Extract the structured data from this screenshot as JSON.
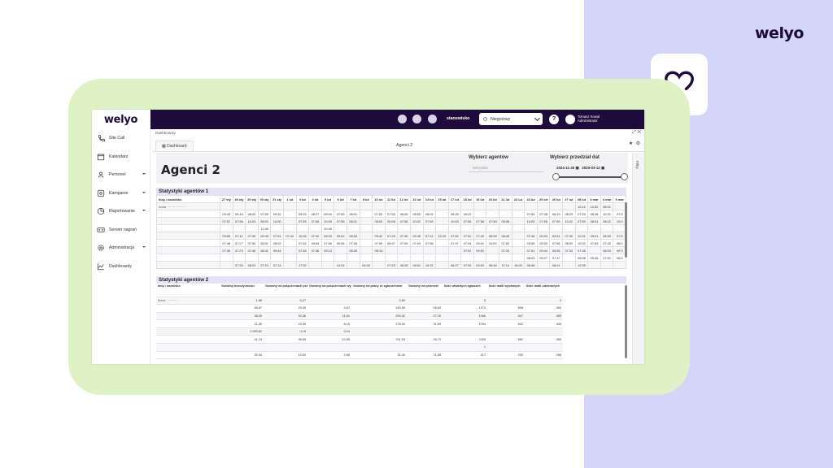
{
  "brand": "welyo",
  "sidebar": {
    "logo": "welyo",
    "items": [
      {
        "label": "Site Call",
        "icon": "phone-icon",
        "caret": false
      },
      {
        "label": "Kalendarz",
        "icon": "calendar-icon",
        "caret": false
      },
      {
        "label": "Personel",
        "icon": "users-icon",
        "caret": true
      },
      {
        "label": "Kampanie",
        "icon": "campaign-icon",
        "caret": true
      },
      {
        "label": "Raportowanie",
        "icon": "pie-chart-icon",
        "caret": true
      },
      {
        "label": "Serwer nagrań",
        "icon": "tape-icon",
        "caret": false
      },
      {
        "label": "Administracja",
        "icon": "gear-icon",
        "caret": true
      },
      {
        "label": "Dashboardy",
        "icon": "trend-chart-icon",
        "caret": false
      }
    ]
  },
  "topbar": {
    "stanowisko": "stanowisko",
    "status": "Niegotowy",
    "help": "?",
    "user_line1": "Tomasz Kowal",
    "user_line2": "Administrator",
    "accent": "#1e0b3b",
    "status_ok": "#58c34e"
  },
  "breadcrumb": "Dashboardy",
  "tab": {
    "label": "Dashboard",
    "title": "Agenci 2"
  },
  "filters": {
    "page_title": "Agenci 2",
    "agents_label": "Wybierz agentów",
    "agents_placeholder": "Wszystkie",
    "range_label": "Wybierz przedział dat",
    "date_from": "2024-11-26",
    "date_to": "2025-03-12",
    "side_panel": "Filtry"
  },
  "stats1": {
    "title": "Statystyki agentów 1",
    "name_header": "Imię i nazwisko",
    "date_headers": [
      "27 sty",
      "28 sty",
      "29 sty",
      "30 sty",
      "31 sty",
      "1 lut",
      "3 lut",
      "4 lut",
      "5 lut",
      "6 lut",
      "7 lut",
      "8 lut",
      "10 lut",
      "11 lut",
      "12 lut",
      "13 lut",
      "14 lut",
      "15 lut",
      "17 lut",
      "18 lut",
      "19 lut",
      "20 lut",
      "21 lut",
      "23 lut",
      "24 lut",
      "25 lut",
      "26 lut",
      "27 lut",
      "28 lut",
      "3 mar",
      "4 mar",
      "5 mar"
    ],
    "rows": [
      {
        "name": "Anna ·················",
        "cells": [
          "",
          "",
          "",
          "",
          "",
          "",
          "",
          "",
          "",
          "",
          "",
          "",
          "",
          "",
          "",
          "",
          "",
          "",
          "",
          "",
          "",
          "",
          "",
          "",
          "",
          "",
          "",
          "",
          "10:12",
          "12:52",
          "08:01",
          ""
        ]
      },
      {
        "name": "",
        "cells": [
          "09:43",
          "09:44",
          "08:03",
          "07:59",
          "09:32",
          "",
          "09:15",
          "08:27",
          "08:00",
          "07:59",
          "08:01",
          "",
          "07:59",
          "07:55",
          "08:26",
          "08:59",
          "08:01",
          "",
          "08:25",
          "09:22",
          "",
          "",
          "",
          "",
          "07:54",
          "07:38",
          "08:19",
          "08:23",
          "07:53",
          "08:38",
          "10:21",
          "07:5"
        ]
      },
      {
        "name": "",
        "cells": [
          "07:57",
          "07:56",
          "10:03",
          "08:01",
          "10:00",
          "",
          "07:59",
          "07:56",
          "10:09",
          "07:58",
          "08:01",
          "",
          "08:00",
          "09:58",
          "07:56",
          "10:02",
          "07:59",
          "",
          "10:00",
          "07:55",
          "07:58",
          "07:58",
          "09:59",
          "",
          "10:00",
          "07:55",
          "07:59",
          "10:02",
          "07:59",
          "08:01",
          "08:12",
          "10:0"
        ]
      },
      {
        "name": "",
        "cells": [
          "",
          "",
          "",
          "11:45",
          "",
          "",
          "",
          "",
          "10:45",
          "",
          "",
          "",
          "",
          "",
          "",
          "",
          "",
          "",
          "",
          "",
          "",
          "",
          "",
          "",
          "",
          "",
          "",
          "",
          "",
          "",
          "",
          ""
        ]
      },
      {
        "name": "",
        "cells": [
          "09:55",
          "07:41",
          "07:59",
          "09:49",
          "07:51",
          "07:42",
          "10:05",
          "07:42",
          "08:00",
          "09:52",
          "08:54",
          "",
          "09:42",
          "07:29",
          "07:30",
          "09:45",
          "07:21",
          "10:39",
          "07:52",
          "07:51",
          "07:40",
          "08:08",
          "08:45",
          "",
          "07:46",
          "09:53",
          "09:51",
          "07:40",
          "10:01",
          "09:01",
          "08:55",
          "07:5"
        ]
      },
      {
        "name": "",
        "cells": [
          "07:48",
          "07:27",
          "07:52",
          "08:01",
          "08:02",
          "",
          "07:52",
          "09:54",
          "07:59",
          "09:56",
          "07:44",
          "",
          "07:59",
          "08:57",
          "07:59",
          "07:03",
          "07:56",
          "",
          "07:47",
          "07:54",
          "09:01",
          "10:00",
          "07:52",
          "",
          "09:56",
          "09:53",
          "07:56",
          "08:02",
          "10:02",
          "07:59",
          "07:42",
          "08:0"
        ]
      },
      {
        "name": "",
        "cells": [
          "07:36",
          "07:23",
          "07:46",
          "08:41",
          "09:44",
          "",
          "07:46",
          "07:36",
          "09:13",
          "",
          "08:39",
          "",
          "08:14",
          "",
          "",
          "",
          "",
          "",
          "",
          "07:51",
          "09:52",
          "",
          "07:33",
          "",
          "07:51",
          "09:44",
          "09:55",
          "07:33",
          "07:48",
          "",
          "08:03",
          "09:3"
        ]
      },
      {
        "name": "",
        "cells": [
          "",
          "",
          "",
          "",
          "",
          "",
          "",
          "",
          "",
          "",
          "",
          "",
          "",
          "",
          "",
          "",
          "",
          "",
          "",
          "",
          "",
          "",
          "",
          "",
          "08:03",
          "09:27",
          "07:47",
          "",
          "08:08",
          "09:46",
          "07:52",
          "06:5"
        ]
      },
      {
        "name": "",
        "cells": [
          "",
          "07:35",
          "08:23",
          "07:23",
          "07:14",
          "",
          "17:30",
          "",
          "",
          "13:04",
          "",
          "04:28",
          "",
          "07:23",
          "08:28",
          "08:51",
          "15:31",
          "",
          "08:27",
          "07:09",
          "09:00",
          "08:48",
          "11:14",
          "16:09",
          "08:48",
          "",
          "08:41",
          "",
          "12:05",
          "",
          "",
          ""
        ]
      }
    ]
  },
  "stats2": {
    "title": "Statystyki agentów 2",
    "headers": [
      "Imię i nazwisko",
      "Godziny bezczynności",
      "Godziny na połączeniach przychodzących",
      "Godziny na połączeniach wychodzących",
      "Godziny na pracy ze zgłoszeniem",
      "Godziny na przerwie",
      "Ilość otwartych zgłoszeń",
      "Ilość maili wysłanych",
      "Ilość maili odebranych"
    ],
    "rows": [
      {
        "name": "Anna · ·········",
        "cells": [
          "1,98",
          "0,27",
          "",
          "0,59",
          "",
          "5",
          "",
          "3"
        ]
      },
      {
        "name": "",
        "cells": [
          "86,87",
          "29,00",
          "4,67",
          "183,55",
          "18,83",
          "1373",
          "606",
          "363"
        ]
      },
      {
        "name": "",
        "cells": [
          "38,05",
          "30,36",
          "11,61",
          "293,32",
          "27,16",
          "1066",
          "547",
          "365"
        ]
      },
      {
        "name": "",
        "cells": [
          "41,35",
          "20,55",
          "6,19",
          "178,32",
          "31,69",
          "1094",
          "632",
          "345"
        ]
      },
      {
        "name": "",
        "cells": [
          "1.059,82",
          "0,15",
          "0,14",
          "",
          "",
          "",
          "",
          ""
        ]
      },
      {
        "name": "",
        "cells": [
          "41,24",
          "36,65",
          "10,56",
          "211,94",
          "28,72",
          "1165",
          "682",
          "365"
        ]
      },
      {
        "name": "",
        "cells": [
          "",
          "",
          "",
          "",
          "",
          "1",
          "",
          ""
        ]
      },
      {
        "name": "",
        "cells": [
          "30,34",
          "14,00",
          "2,85",
          "31,40",
          "11,38",
          "417",
          "252",
          "288"
        ]
      }
    ]
  }
}
